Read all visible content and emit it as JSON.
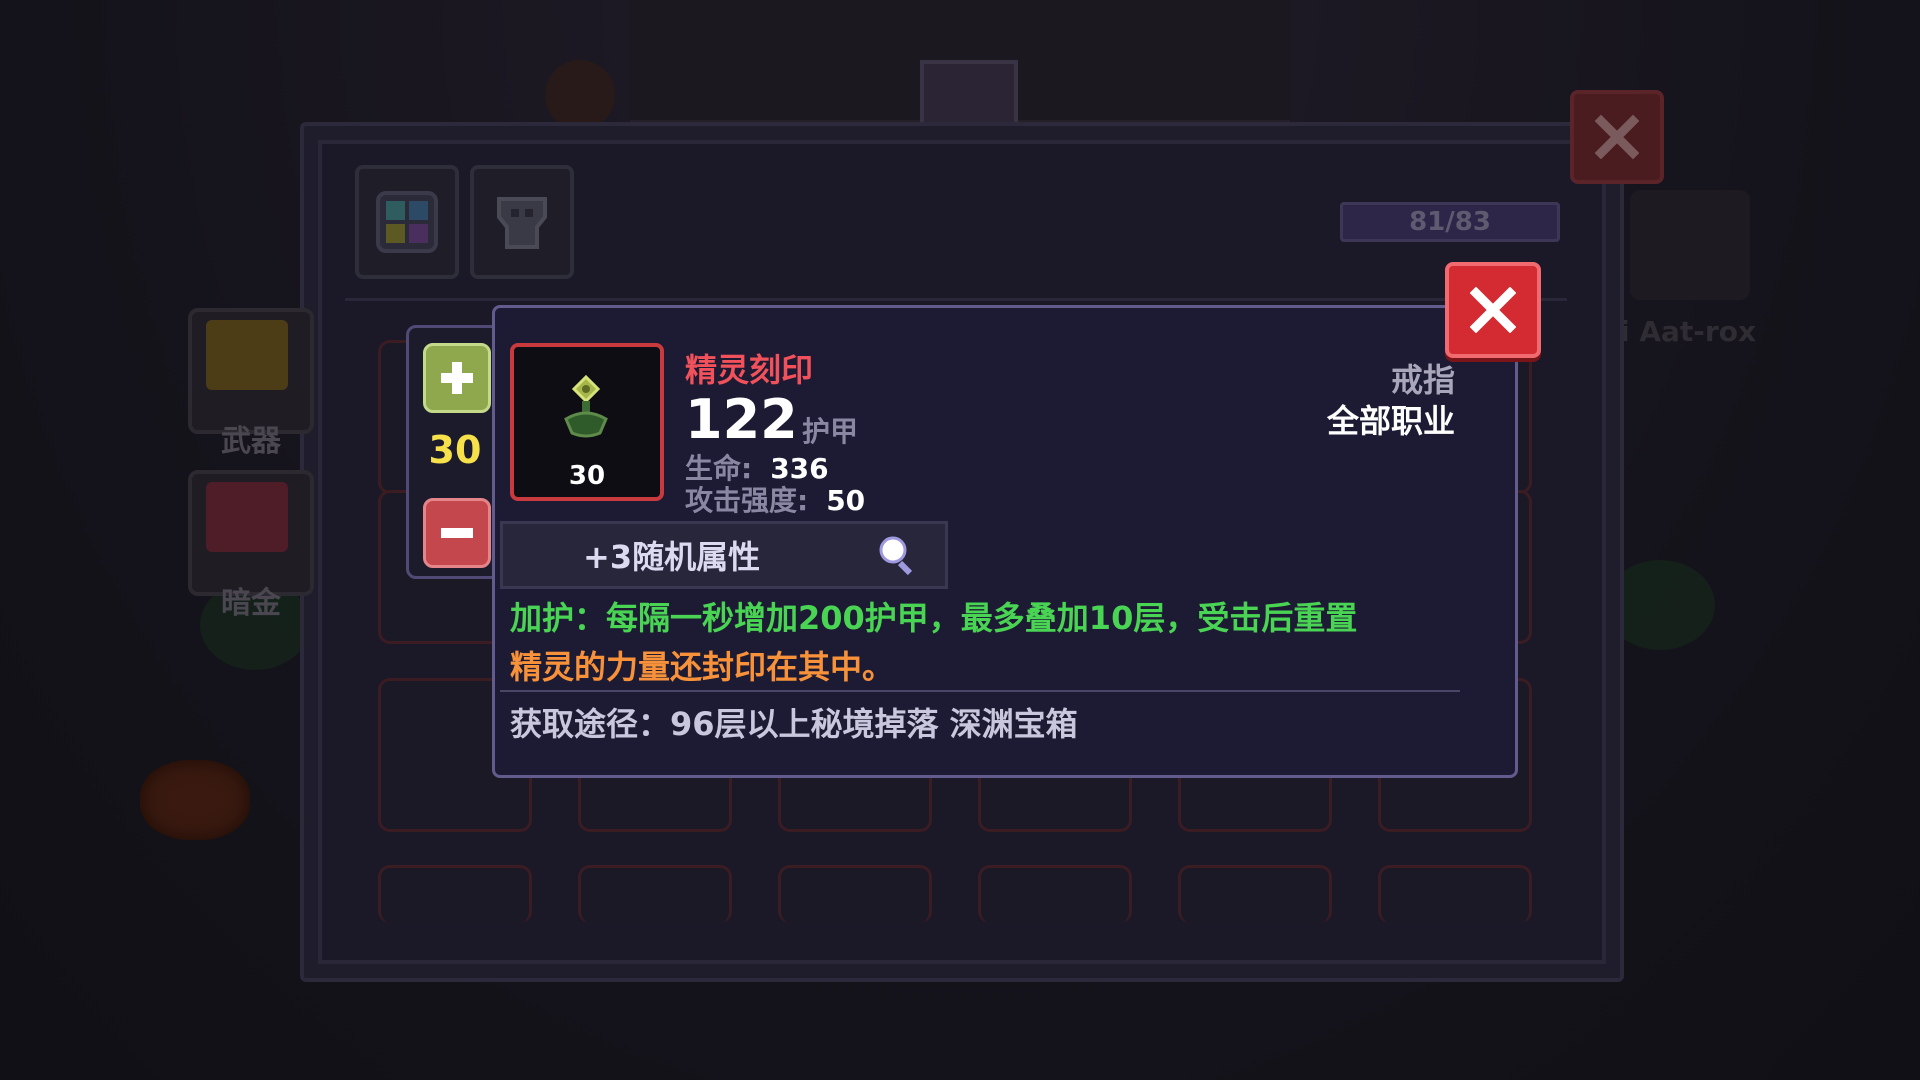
{
  "background": {
    "side_character_name": "i Aat-rox"
  },
  "inventory": {
    "capacity": "81/83",
    "tabs": [
      {
        "icon": "grid-icon"
      },
      {
        "icon": "armor-icon"
      }
    ],
    "categories": [
      {
        "label": "武器",
        "icon": "chest-icon"
      },
      {
        "label": "暗金",
        "icon": "bag-icon"
      }
    ]
  },
  "stepper": {
    "quantity": "30"
  },
  "item": {
    "name": "精灵刻印",
    "level": "30",
    "armor_value": "122",
    "armor_label": "护甲",
    "stats": [
      {
        "label": "生命:",
        "value": "336"
      },
      {
        "label": "攻击强度:",
        "value": "50"
      }
    ],
    "slot_type": "戒指",
    "class_requirement": "全部职业",
    "random_attributes": "+3随机属性",
    "effect": "加护：每隔一秒增加200护甲，最多叠加10层，受击后重置",
    "flavor": "精灵的力量还封印在其中。",
    "source": "获取途径：96层以上秘境掉落 深渊宝箱"
  },
  "colors": {
    "item_name": "#f0515a",
    "effect_text": "#49d454",
    "flavor_text": "#f7913a",
    "quantity": "#f6e14a",
    "close_button": "#d42a31",
    "plus_button": "#8fa84e",
    "minus_button": "#c5474e"
  }
}
